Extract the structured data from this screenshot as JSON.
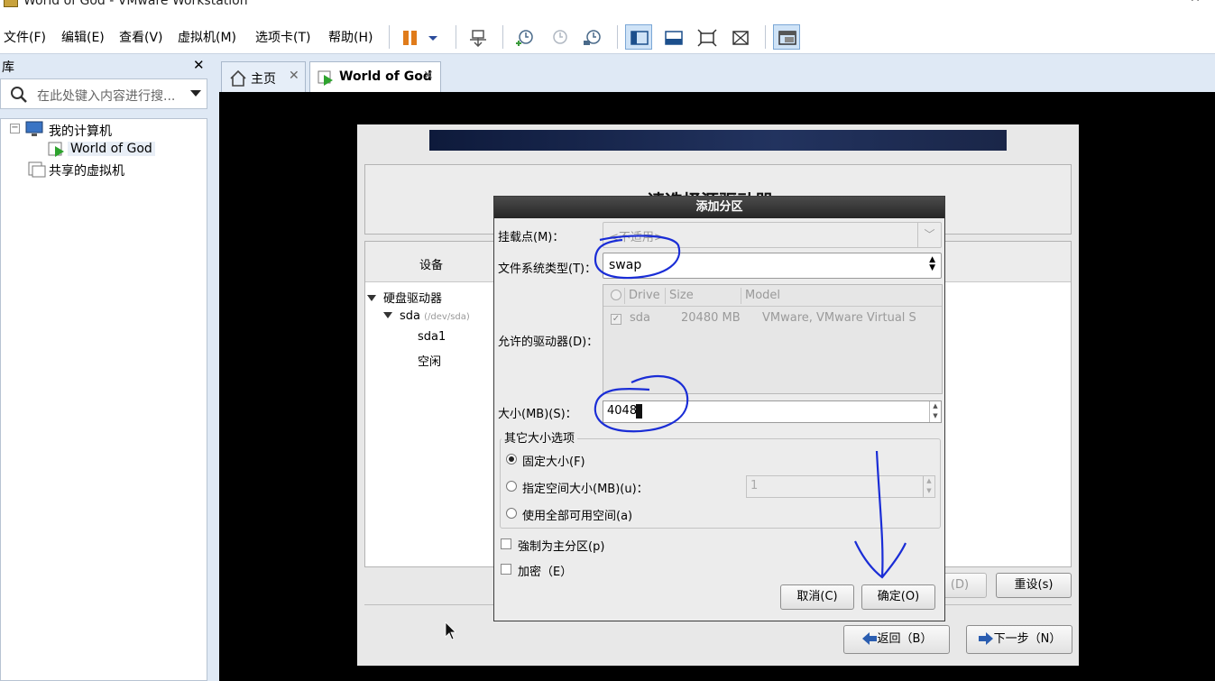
{
  "window": {
    "title": "World of God - VMware Workstation",
    "minimize": "─",
    "close": "✕"
  },
  "menu": {
    "file": "文件(F)",
    "edit": "编辑(E)",
    "view": "查看(V)",
    "vm": "虚拟机(M)",
    "tabs": "选项卡(T)",
    "help": "帮助(H)"
  },
  "library": {
    "title": "库",
    "close": "✕",
    "search_placeholder": "在此处键入内容进行搜...",
    "tree": {
      "my_computer": "我的计算机",
      "vm_name": "World of God",
      "shared": "共享的虚拟机",
      "collapse": "−"
    }
  },
  "tabs": [
    {
      "label": "主页",
      "close": "✕"
    },
    {
      "label": "World of God",
      "close": "✕"
    }
  ],
  "installer": {
    "heading": "请选择源驱动器",
    "device_header": "设备",
    "devices": {
      "group": "硬盘驱动器",
      "disk": "sda",
      "disk_path": "(/dev/sda)",
      "part1": "sda1",
      "free": "空闲"
    },
    "buttons": {
      "delete": "(D)",
      "reset": "重设(s)",
      "back": "返回（B）",
      "next": "下一步（N）"
    }
  },
  "dialog": {
    "title": "添加分区",
    "mount_label": "挂载点(M)：",
    "mount_value": "<不适用>",
    "fstype_label": "文件系统类型(T)：",
    "fstype_value": "swap",
    "drives_label": "允许的驱动器(D)：",
    "drive_columns": {
      "drive": "Drive",
      "size": "Size",
      "model": "Model"
    },
    "drives": [
      {
        "drive": "sda",
        "size": "20480 MB",
        "model": "VMware, VMware Virtual S",
        "checked": true
      }
    ],
    "size_label": "大小(MB)(S)：",
    "size_value": "4048",
    "other_size_label": "其它大小选项",
    "options": {
      "fixed": "固定大小(F)",
      "up_to": "指定空间大小(MB)(u)：",
      "up_to_value": "1",
      "fill": "使用全部可用空间(a)"
    },
    "primary": "強制为主分区(p)",
    "encrypt": "加密（E）",
    "cancel": "取消(C)",
    "ok": "确定(O)"
  },
  "colors": {
    "annotation": "#1a2dd6",
    "banner": "#0e1a3b",
    "window_bg": "#dfe9f5"
  }
}
